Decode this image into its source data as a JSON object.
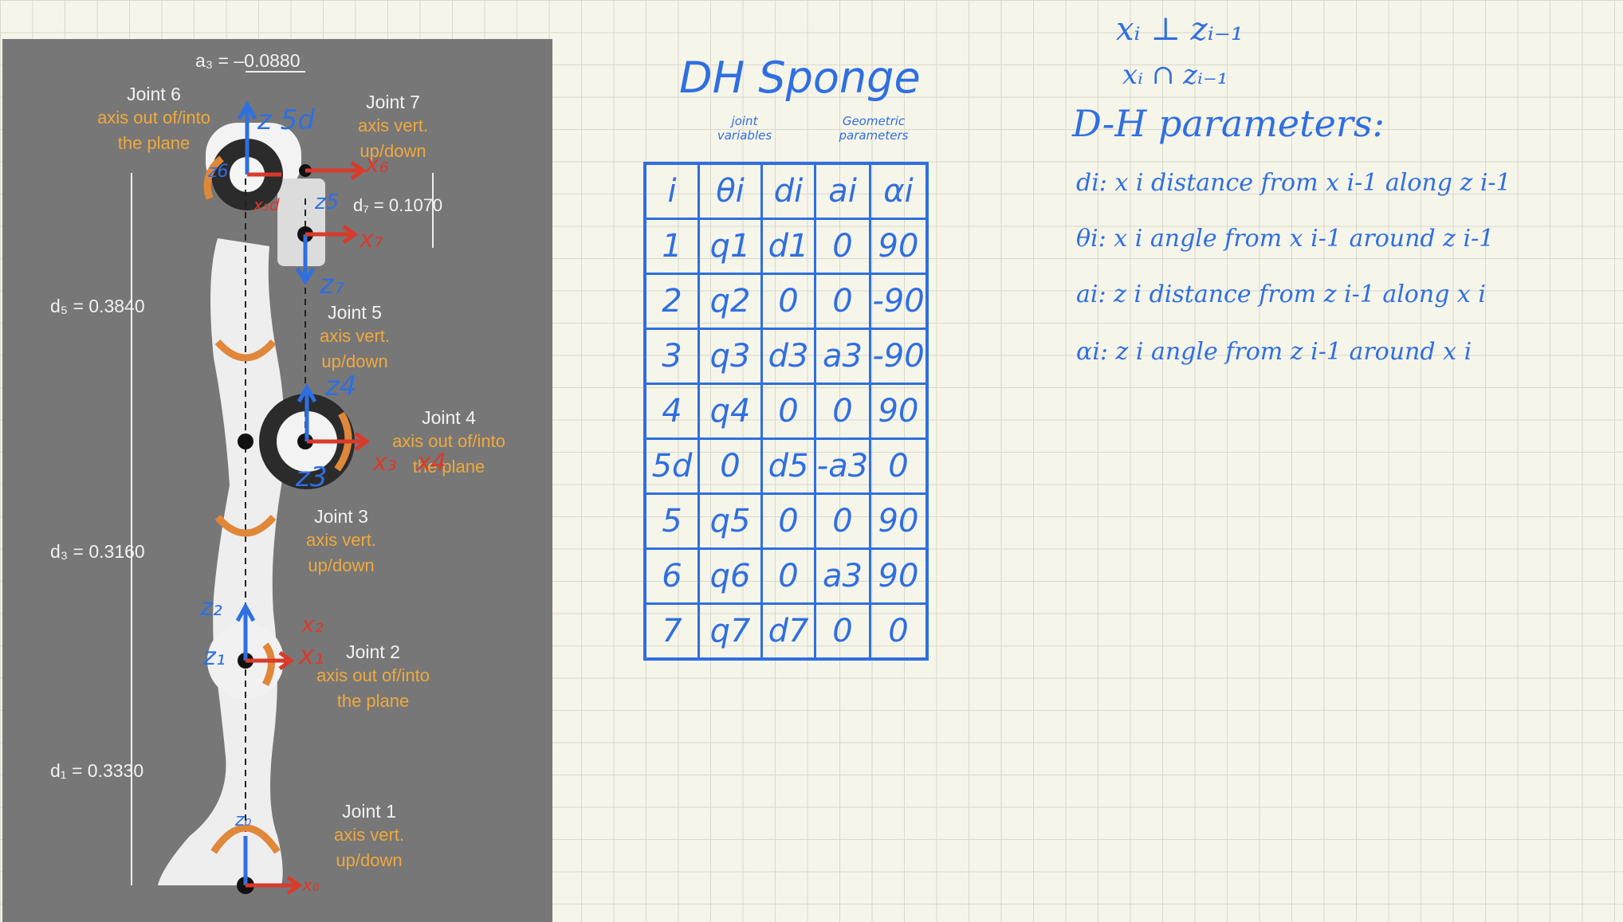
{
  "robot": {
    "dimensions": {
      "a3": "a₃ = –0.0880",
      "d7": "d₇ = 0.1070",
      "d5": "d₅ = 0.3840",
      "d3": "d₃ = 0.3160",
      "d1": "d₁ = 0.3330"
    },
    "joints": [
      {
        "name": "Joint 6",
        "desc1": "axis out of/into",
        "desc2": "the plane"
      },
      {
        "name": "Joint 7",
        "desc1": "axis vert.",
        "desc2": "up/down"
      },
      {
        "name": "Joint 5",
        "desc1": "axis vert.",
        "desc2": "up/down"
      },
      {
        "name": "Joint 4",
        "desc1": "axis out of/into",
        "desc2": "the plane"
      },
      {
        "name": "Joint 3",
        "desc1": "axis vert.",
        "desc2": "up/down"
      },
      {
        "name": "Joint 2",
        "desc1": "axis out of/into",
        "desc2": "the plane"
      },
      {
        "name": "Joint 1",
        "desc1": "axis vert.",
        "desc2": "up/down"
      }
    ],
    "frame_labels": {
      "z5d": "z 5d",
      "x6": "x₆",
      "x5d": "x₅d",
      "z6": "z6",
      "z5": "z5",
      "x7": "x₇",
      "z7": "z₇",
      "z4": "z4",
      "x3": "x₃",
      "x4": "x4",
      "z3": "z3",
      "z2": "z₂",
      "x2": "x₂",
      "z1": "z₁",
      "x1": "x₁",
      "z0": "z₀",
      "x0": "x₀"
    }
  },
  "dh_table": {
    "title": "DH Sponge",
    "sub1": "joint variables",
    "sub2": "Geometric parameters",
    "headers": [
      "i",
      "θi",
      "di",
      "ai",
      "αi"
    ],
    "rows": [
      [
        "1",
        "q1",
        "d1",
        "0",
        "90"
      ],
      [
        "2",
        "q2",
        "0",
        "0",
        "-90"
      ],
      [
        "3",
        "q3",
        "d3",
        "a3",
        "-90"
      ],
      [
        "4",
        "q4",
        "0",
        "0",
        "90"
      ],
      [
        "5d",
        "0",
        "d5",
        "-a3",
        "0"
      ],
      [
        "5",
        "q5",
        "0",
        "0",
        "90"
      ],
      [
        "6",
        "q6",
        "0",
        "a3",
        "90"
      ],
      [
        "7",
        "q7",
        "d7",
        "0",
        "0"
      ]
    ]
  },
  "notes": {
    "line1": "xᵢ ⊥ zᵢ₋₁",
    "line2": "xᵢ ∩ zᵢ₋₁",
    "heading": "D-H parameters:",
    "di": "di: x i distance from x i-1 along z i-1",
    "theta": "θi: x i angle from x i-1 around z i-1",
    "ai": "ai: z i distance from z i-1 along x i",
    "alpha": "αi: z i angle from z i-1 around x i"
  }
}
